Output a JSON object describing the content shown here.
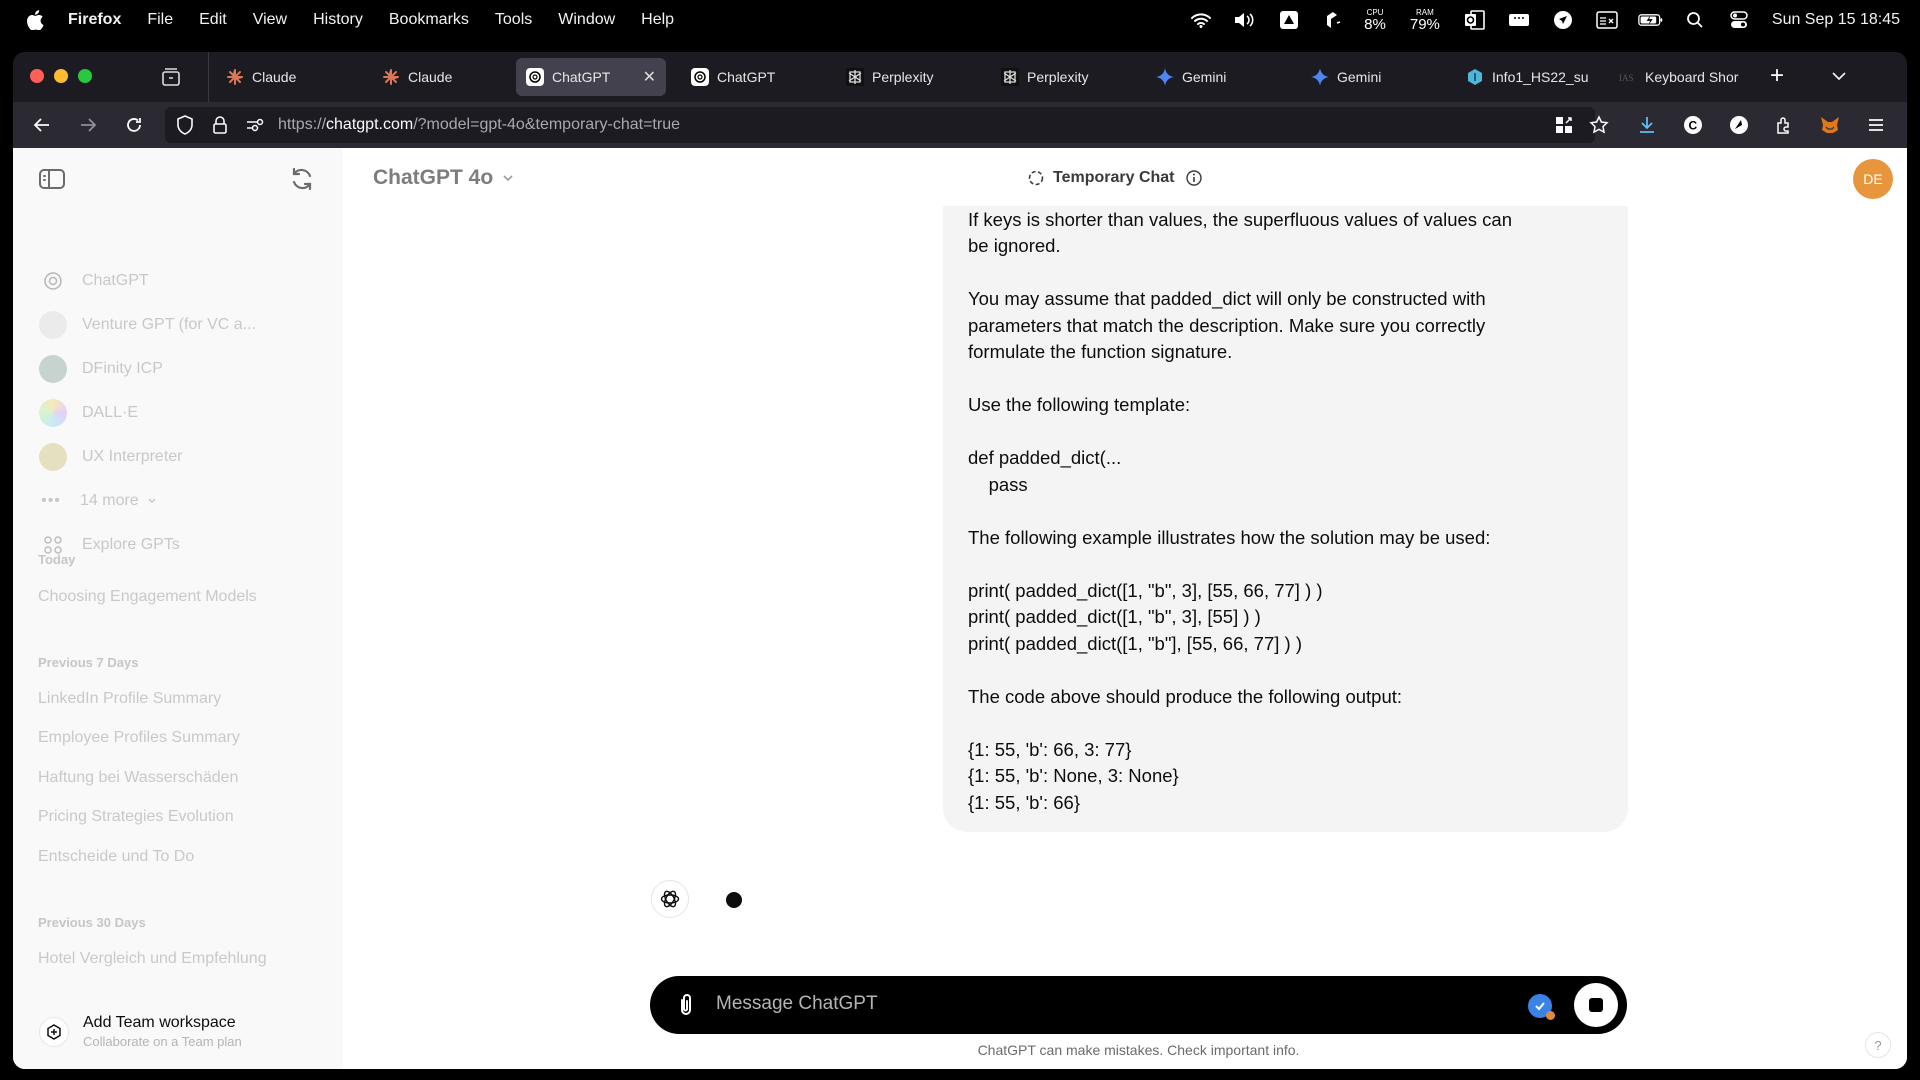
{
  "menubar": {
    "app_name": "Firefox",
    "items": [
      "File",
      "Edit",
      "View",
      "History",
      "Bookmarks",
      "Tools",
      "Window",
      "Help"
    ],
    "tray": {
      "cpu_label": "CPU",
      "cpu_value": "8%",
      "ram_label": "RAM",
      "ram_value": "79%",
      "clock": "Sun Sep 15  18:45"
    }
  },
  "browser": {
    "tabs": [
      {
        "label": "Claude",
        "icon": "claude-icon",
        "active": false
      },
      {
        "label": "Claude",
        "icon": "claude-icon",
        "active": false
      },
      {
        "label": "ChatGPT",
        "icon": "openai-icon",
        "active": true
      },
      {
        "label": "ChatGPT",
        "icon": "openai-icon",
        "active": false
      },
      {
        "label": "Perplexity",
        "icon": "perplexity-icon",
        "active": false
      },
      {
        "label": "Perplexity",
        "icon": "perplexity-icon",
        "active": false
      },
      {
        "label": "Gemini",
        "icon": "gemini-icon",
        "active": false
      },
      {
        "label": "Gemini",
        "icon": "gemini-icon",
        "active": false
      },
      {
        "label": "Info1_HS22_su",
        "icon": "hexagon-icon",
        "active": false
      },
      {
        "label": "Keyboard Shor",
        "icon": "ias-icon",
        "active": false
      }
    ],
    "close_glyph": "✕",
    "new_tab_glyph": "+",
    "url_prefix": "https://",
    "url_domain": "chatgpt.com",
    "url_rest": "/?model=gpt-4o&temporary-chat=true"
  },
  "sidebar": {
    "gpts": [
      {
        "label": "ChatGPT",
        "icon": "openai-icon"
      },
      {
        "label": "Venture GPT (for VC a...",
        "icon": "venture-gpt-icon"
      },
      {
        "label": "DFinity ICP",
        "icon": "dfinity-icon"
      },
      {
        "label": "DALL·E",
        "icon": "dalle-icon"
      },
      {
        "label": "UX Interpreter",
        "icon": "ux-interpreter-icon"
      }
    ],
    "more_label": "14 more",
    "explore_label": "Explore GPTs",
    "sections": [
      {
        "label": "Today",
        "items": [
          "Choosing Engagement Models"
        ]
      },
      {
        "label": "Previous 7 Days",
        "items": [
          "LinkedIn Profile Summary",
          "Employee Profiles Summary",
          "Haftung bei Wasserschäden",
          "Pricing Strategies Evolution",
          "Entscheide und To Do"
        ]
      },
      {
        "label": "Previous 30 Days",
        "items": [
          "Hotel Vergleich und Empfehlung"
        ]
      }
    ],
    "team": {
      "title": "Add Team workspace",
      "subtitle": "Collaborate on a Team plan"
    }
  },
  "header": {
    "model": "ChatGPT 4o",
    "temporary_chat": "Temporary Chat",
    "avatar_initials": "DE"
  },
  "conversation": {
    "user_message_paragraphs": [
      "keys, the values for the remaining keys should be set to be padding.\nIf keys is shorter than values, the superfluous values of values can\nbe ignored.",
      "You may assume that padded_dict will only be constructed with\nparameters that match the description. Make sure you correctly\nformulate the function signature.",
      "Use the following template:",
      "def padded_dict(...\n    pass",
      "The following example illustrates how the solution may be used:",
      "print( padded_dict([1, \"b\", 3], [55, 66, 77] ) )\nprint( padded_dict([1, \"b\", 3], [55] ) )\nprint( padded_dict([1, \"b\"], [55, 66, 77] ) )",
      "The code above should produce the following output:",
      "{1: 55, 'b': 66, 3: 77}\n{1: 55, 'b': None, 3: None}\n{1: 55, 'b': 66}"
    ],
    "assistant_status": "typing"
  },
  "composer": {
    "placeholder": "Message ChatGPT",
    "disclaimer": "ChatGPT can make mistakes. Check important info.",
    "help_glyph": "?"
  },
  "colors": {
    "avatar": "#e8963d",
    "active_tab": "#42414d",
    "bubble": "#f4f4f4",
    "composer": "#000000"
  }
}
